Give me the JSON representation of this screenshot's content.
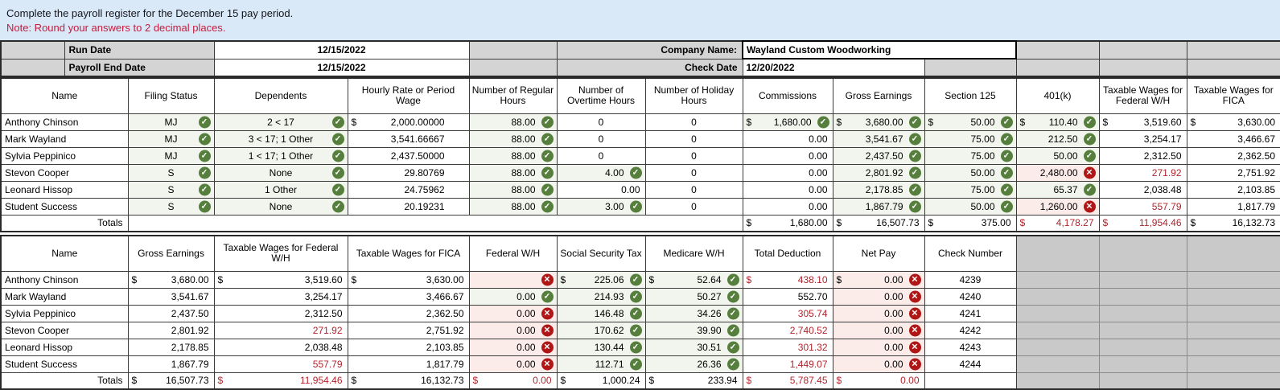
{
  "banner": {
    "line1": "Complete the payroll register for the December 15 pay period.",
    "line2": "Note: Round your answers to 2 decimal places."
  },
  "info": {
    "run_date_label": "Run Date",
    "run_date_value": "12/15/2022",
    "payroll_end_label": "Payroll End Date",
    "payroll_end_value": "12/15/2022",
    "company_label": "Company Name:",
    "company_value": "Wayland Custom Woodworking",
    "check_date_label": "Check Date",
    "check_date_value": "12/20/2022"
  },
  "colors": {
    "banner_bg": "#d9e9f8",
    "note_red": "#c31c3d",
    "correct_icon_green": "#567f3e",
    "incorrect_icon_red": "#b01616",
    "error_text_red": "#b3232c",
    "correct_cell_bg": "#f1f5ed",
    "incorrect_cell_bg": "#fbecea",
    "gray_fill": "#d4d4d4",
    "gray_block": "#c9c9c9"
  },
  "icons": {
    "correct": "correct-check-icon",
    "incorrect": "incorrect-x-icon"
  },
  "table1": {
    "column_keys": [
      "name",
      "filing-status",
      "dependents",
      "hourly-rate",
      "regular-hours",
      "overtime-hours",
      "holiday-hours",
      "commissions",
      "gross-earnings",
      "section-125",
      "401k",
      "taxable-wages-federal",
      "taxable-wages-fica"
    ],
    "headers": [
      "Name",
      "Filing Status",
      "Dependents",
      "Hourly Rate or Period Wage",
      "Number of Regular Hours",
      "Number of Overtime Hours",
      "Number of Holiday Hours",
      "Commissions",
      "Gross Earnings",
      "Section 125",
      "401(k)",
      "Taxable Wages for Federal W/H",
      "Taxable Wages for FICA"
    ],
    "rows": [
      {
        "name": "Anthony Chinson",
        "cells": [
          [
            "MJ",
            "c ok"
          ],
          [
            "2 < 17",
            "c ok"
          ],
          [
            "2,000.00000",
            "$ pad"
          ],
          [
            "88.00",
            "ok"
          ],
          [
            "0",
            "c"
          ],
          [
            "0",
            "c"
          ],
          [
            "1,680.00",
            "$ ok"
          ],
          [
            "3,680.00",
            "$ ok"
          ],
          [
            "50.00",
            "$ ok"
          ],
          [
            "110.40",
            "$ ok"
          ],
          [
            "3,519.60",
            "$"
          ],
          [
            "3,630.00",
            "$"
          ]
        ]
      },
      {
        "name": "Mark Wayland",
        "cells": [
          [
            "MJ",
            "c ok"
          ],
          [
            "3 < 17; 1 Other",
            "c ok"
          ],
          [
            "3,541.66667",
            "pad"
          ],
          [
            "88.00",
            "ok"
          ],
          [
            "0",
            "c"
          ],
          [
            "0",
            "c"
          ],
          [
            "0.00",
            ""
          ],
          [
            "3,541.67",
            "ok"
          ],
          [
            "75.00",
            "ok"
          ],
          [
            "212.50",
            "ok"
          ],
          [
            "3,254.17",
            ""
          ],
          [
            "3,466.67",
            ""
          ]
        ]
      },
      {
        "name": "Sylvia Peppinico",
        "cells": [
          [
            "MJ",
            "c ok"
          ],
          [
            "1 < 17; 1 Other",
            "c ok"
          ],
          [
            "2,437.50000",
            "pad"
          ],
          [
            "88.00",
            "ok"
          ],
          [
            "0",
            "c"
          ],
          [
            "0",
            "c"
          ],
          [
            "0.00",
            ""
          ],
          [
            "2,437.50",
            "ok"
          ],
          [
            "75.00",
            "ok"
          ],
          [
            "50.00",
            "ok"
          ],
          [
            "2,312.50",
            ""
          ],
          [
            "2,362.50",
            ""
          ]
        ]
      },
      {
        "name": "Stevon Cooper",
        "cells": [
          [
            "S",
            "c ok"
          ],
          [
            "None",
            "c ok"
          ],
          [
            "29.80769",
            "pad"
          ],
          [
            "88.00",
            "ok"
          ],
          [
            "4.00",
            "ok"
          ],
          [
            "0",
            "c"
          ],
          [
            "0.00",
            ""
          ],
          [
            "2,801.92",
            "ok"
          ],
          [
            "50.00",
            "ok"
          ],
          [
            "2,480.00",
            "err"
          ],
          [
            "271.92",
            "red"
          ],
          [
            "2,751.92",
            ""
          ]
        ]
      },
      {
        "name": "Leonard Hissop",
        "cells": [
          [
            "S",
            "c ok"
          ],
          [
            "1 Other",
            "c ok"
          ],
          [
            "24.75962",
            "pad"
          ],
          [
            "88.00",
            "ok"
          ],
          [
            "0.00",
            ""
          ],
          [
            "0",
            "c"
          ],
          [
            "0.00",
            ""
          ],
          [
            "2,178.85",
            "ok"
          ],
          [
            "75.00",
            "ok"
          ],
          [
            "65.37",
            "ok"
          ],
          [
            "2,038.48",
            ""
          ],
          [
            "2,103.85",
            ""
          ]
        ]
      },
      {
        "name": "Student Success",
        "cells": [
          [
            "S",
            "c ok"
          ],
          [
            "None",
            "c ok"
          ],
          [
            "20.19231",
            "pad"
          ],
          [
            "88.00",
            "ok"
          ],
          [
            "3.00",
            "ok"
          ],
          [
            "0",
            "c"
          ],
          [
            "0.00",
            ""
          ],
          [
            "1,867.79",
            "ok"
          ],
          [
            "50.00",
            "ok"
          ],
          [
            "1,260.00",
            "err"
          ],
          [
            "557.79",
            "red"
          ],
          [
            "1,817.79",
            ""
          ]
        ]
      }
    ],
    "totals_label": "Totals",
    "totals_cells": [
      [
        "1,680.00",
        "$"
      ],
      [
        "16,507.73",
        "$"
      ],
      [
        "375.00",
        "$"
      ],
      [
        "4,178.27",
        "$ red"
      ],
      [
        "11,954.46",
        "$ red"
      ],
      [
        "16,132.73",
        "$"
      ]
    ]
  },
  "table2": {
    "column_keys": [
      "name",
      "gross-earnings",
      "taxable-wages-federal",
      "taxable-wages-fica",
      "federal-wh",
      "social-security-tax",
      "medicare-wh",
      "total-deduction",
      "net-pay",
      "check-number",
      "blank-1",
      "blank-2",
      "blank-3"
    ],
    "headers": [
      "Name",
      "Gross Earnings",
      "Taxable Wages for Federal W/H",
      "Taxable Wages for FICA",
      "Federal W/H",
      "Social Security Tax",
      "Medicare W/H",
      "Total Deduction",
      "Net Pay",
      "Check Number",
      "",
      "",
      ""
    ],
    "rows": [
      {
        "name": "Anthony Chinson",
        "cells": [
          [
            "3,680.00",
            "$"
          ],
          [
            "3,519.60",
            "$"
          ],
          [
            "3,630.00",
            "$"
          ],
          [
            "",
            "err"
          ],
          [
            "225.06",
            "$ ok"
          ],
          [
            "52.64",
            "$ ok"
          ],
          [
            "438.10",
            "$ red"
          ],
          [
            "0.00",
            "$ err"
          ],
          [
            "4239",
            "c"
          ]
        ]
      },
      {
        "name": "Mark Wayland",
        "cells": [
          [
            "3,541.67",
            ""
          ],
          [
            "3,254.17",
            ""
          ],
          [
            "3,466.67",
            ""
          ],
          [
            "0.00",
            "ok"
          ],
          [
            "214.93",
            "ok"
          ],
          [
            "50.27",
            "ok"
          ],
          [
            "552.70",
            ""
          ],
          [
            "0.00",
            "err"
          ],
          [
            "4240",
            "c"
          ]
        ]
      },
      {
        "name": "Sylvia Peppinico",
        "cells": [
          [
            "2,437.50",
            ""
          ],
          [
            "2,312.50",
            ""
          ],
          [
            "2,362.50",
            ""
          ],
          [
            "0.00",
            "err"
          ],
          [
            "146.48",
            "ok"
          ],
          [
            "34.26",
            "ok"
          ],
          [
            "305.74",
            "red"
          ],
          [
            "0.00",
            "err"
          ],
          [
            "4241",
            "c"
          ]
        ]
      },
      {
        "name": "Stevon Cooper",
        "cells": [
          [
            "2,801.92",
            ""
          ],
          [
            "271.92",
            "red"
          ],
          [
            "2,751.92",
            ""
          ],
          [
            "0.00",
            "err"
          ],
          [
            "170.62",
            "ok"
          ],
          [
            "39.90",
            "ok"
          ],
          [
            "2,740.52",
            "red"
          ],
          [
            "0.00",
            "err"
          ],
          [
            "4242",
            "c"
          ]
        ]
      },
      {
        "name": "Leonard Hissop",
        "cells": [
          [
            "2,178.85",
            ""
          ],
          [
            "2,038.48",
            ""
          ],
          [
            "2,103.85",
            ""
          ],
          [
            "0.00",
            "err"
          ],
          [
            "130.44",
            "ok"
          ],
          [
            "30.51",
            "ok"
          ],
          [
            "301.32",
            "red"
          ],
          [
            "0.00",
            "err"
          ],
          [
            "4243",
            "c"
          ]
        ]
      },
      {
        "name": "Student Success",
        "cells": [
          [
            "1,867.79",
            ""
          ],
          [
            "557.79",
            "red"
          ],
          [
            "1,817.79",
            ""
          ],
          [
            "0.00",
            "err"
          ],
          [
            "112.71",
            "ok"
          ],
          [
            "26.36",
            "ok"
          ],
          [
            "1,449.07",
            "red"
          ],
          [
            "0.00",
            "err"
          ],
          [
            "4244",
            "c"
          ]
        ]
      }
    ],
    "totals_label": "Totals",
    "totals_cells": [
      [
        "16,507.73",
        "$"
      ],
      [
        "11,954.46",
        "$ red"
      ],
      [
        "16,132.73",
        "$"
      ],
      [
        "0.00",
        "$ red"
      ],
      [
        "1,000.24",
        "$"
      ],
      [
        "233.94",
        "$"
      ],
      [
        "5,787.45",
        "$ red"
      ],
      [
        "0.00",
        "$ red"
      ]
    ]
  }
}
